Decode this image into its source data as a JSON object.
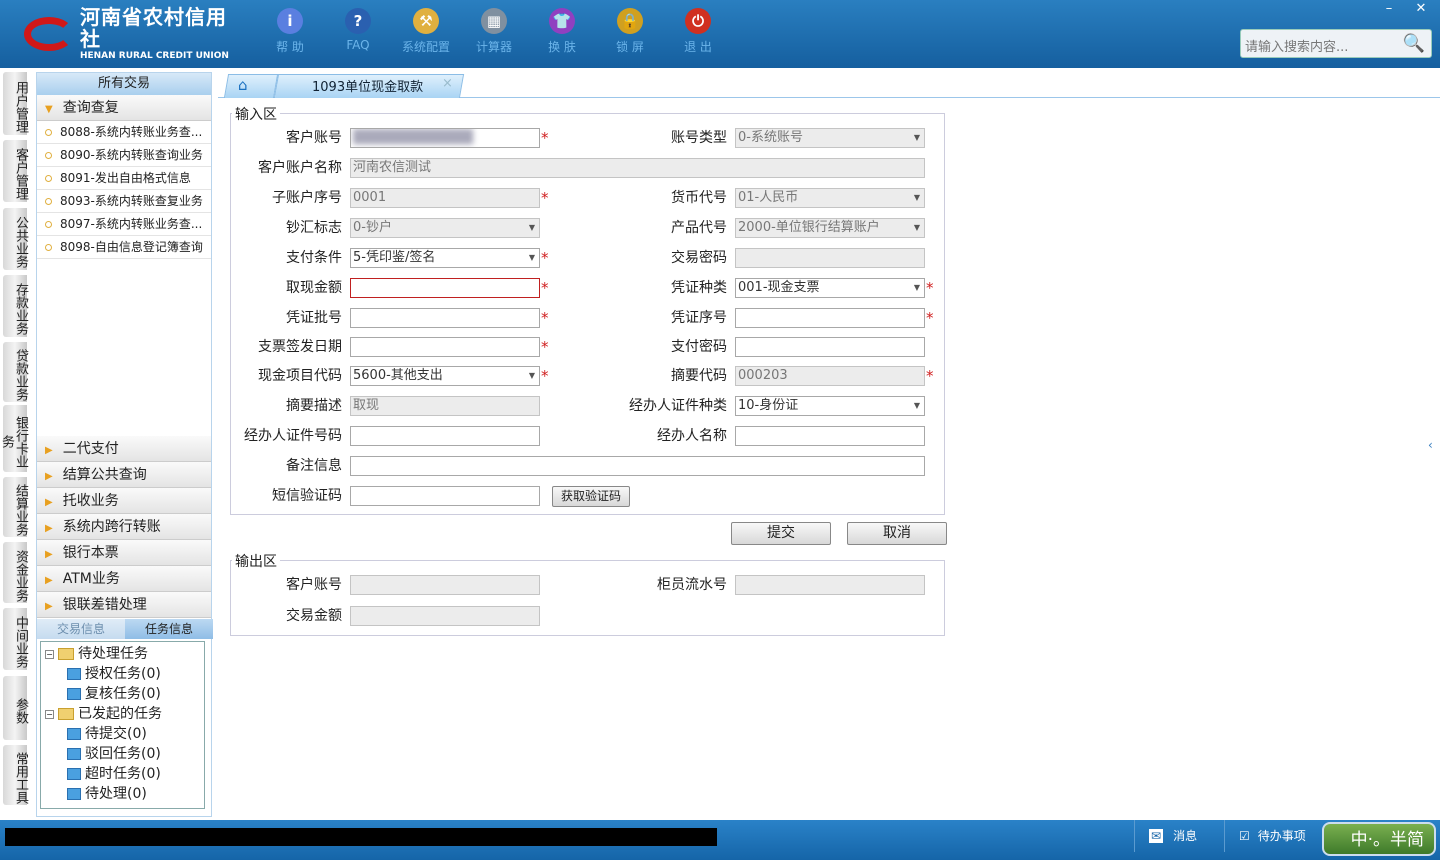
{
  "header": {
    "logo_cn": "河南省农村信用社",
    "logo_en": "HENAN RURAL CREDIT UNION",
    "tools": [
      {
        "label": "帮 助",
        "icon": "info-icon",
        "color": "#5a7fe0",
        "glyph": "i"
      },
      {
        "label": "FAQ",
        "icon": "help-icon",
        "color": "#2a60b0",
        "glyph": "?"
      },
      {
        "label": "系统配置",
        "icon": "toolbox-icon",
        "color": "#e0b040",
        "glyph": "⚒"
      },
      {
        "label": "计算器",
        "icon": "calculator-icon",
        "color": "#8090a0",
        "glyph": "▦"
      },
      {
        "label": "换 肤",
        "icon": "shirt-icon",
        "color": "#9040c0",
        "glyph": "👕"
      },
      {
        "label": "锁 屏",
        "icon": "lock-icon",
        "color": "#d0a020",
        "glyph": "🔒"
      },
      {
        "label": "退 出",
        "icon": "power-icon",
        "color": "#d03020",
        "glyph": "⏻"
      }
    ],
    "search_placeholder": "请输入搜索内容...",
    "minimize": "–",
    "close": "✕"
  },
  "vtabs": [
    "用户管理",
    "客户管理",
    "公共业务",
    "存款业务",
    "贷款业务",
    "银行卡业务",
    "结算业务",
    "资金业务",
    "中间业务",
    "参数",
    "常用工具"
  ],
  "sidebar": {
    "title": "所有交易",
    "open_group": "查询查复",
    "items": [
      "8088-系统内转账业务查...",
      "8090-系统内转账查询业务",
      "8091-发出自由格式信息",
      "8093-系统内转账查复业务",
      "8097-系统内转账业务查...",
      "8098-自由信息登记簿查询"
    ],
    "groups": [
      "二代支付",
      "结算公共查询",
      "托收业务",
      "系统内跨行转账",
      "银行本票",
      "ATM业务",
      "银联差错处理"
    ],
    "task_tabs": [
      "交易信息",
      "任务信息"
    ],
    "tree": [
      {
        "label": "待处理任务",
        "level": 0,
        "folder": true
      },
      {
        "label": "授权任务(0)",
        "level": 1
      },
      {
        "label": "复核任务(0)",
        "level": 1
      },
      {
        "label": "已发起的任务",
        "level": 0,
        "folder": true
      },
      {
        "label": "待提交(0)",
        "level": 1
      },
      {
        "label": "驳回任务(0)",
        "level": 1
      },
      {
        "label": "超时任务(0)",
        "level": 1
      },
      {
        "label": "待处理(0)",
        "level": 1
      }
    ]
  },
  "tabs": {
    "active": "1093单位现金取款",
    "close": "×"
  },
  "input_area": {
    "legend": "输入区",
    "rows": [
      {
        "l": {
          "label": "客户账号",
          "value": "",
          "blur": true,
          "req": true
        },
        "r": {
          "label": "账号类型",
          "value": "0-系统账号",
          "select": true,
          "dis": true
        }
      },
      {
        "l": {
          "label": "客户账户名称",
          "value": "河南农信测试",
          "dis": true,
          "wide": true
        }
      },
      {
        "l": {
          "label": "子账户序号",
          "value": "0001",
          "dis": true,
          "req": true
        },
        "r": {
          "label": "货币代号",
          "value": "01-人民币",
          "select": true,
          "dis": true
        }
      },
      {
        "l": {
          "label": "钞汇标志",
          "value": "0-钞户",
          "select": true,
          "dis": true
        },
        "r": {
          "label": "产品代号",
          "value": "2000-单位银行结算账户",
          "select": true,
          "dis": true
        }
      },
      {
        "l": {
          "label": "支付条件",
          "value": "5-凭印鉴/签名",
          "select": true,
          "req": true
        },
        "r": {
          "label": "交易密码",
          "value": "",
          "dis": true
        }
      },
      {
        "l": {
          "label": "取现金额",
          "value": "",
          "req": true,
          "err": true
        },
        "r": {
          "label": "凭证种类",
          "value": "001-现金支票",
          "select": true,
          "req": true
        }
      },
      {
        "l": {
          "label": "凭证批号",
          "value": "",
          "req": true
        },
        "r": {
          "label": "凭证序号",
          "value": "",
          "req": true
        }
      },
      {
        "l": {
          "label": "支票签发日期",
          "value": "",
          "req": true
        },
        "r": {
          "label": "支付密码",
          "value": ""
        }
      },
      {
        "l": {
          "label": "现金项目代码",
          "value": "5600-其他支出",
          "select": true,
          "req": true
        },
        "r": {
          "label": "摘要代码",
          "value": "000203",
          "dis": true,
          "req": true
        }
      },
      {
        "l": {
          "label": "摘要描述",
          "value": "取现",
          "dis": true
        },
        "r": {
          "label": "经办人证件种类",
          "value": "10-身份证",
          "select": true
        }
      },
      {
        "l": {
          "label": "经办人证件号码",
          "value": ""
        },
        "r": {
          "label": "经办人名称",
          "value": ""
        }
      },
      {
        "l": {
          "label": "备注信息",
          "value": "",
          "wide": true
        }
      },
      {
        "l": {
          "label": "短信验证码",
          "value": ""
        },
        "btn": "获取验证码"
      }
    ]
  },
  "actions": {
    "submit": "提交",
    "cancel": "取消"
  },
  "output_area": {
    "legend": "输出区",
    "rows": [
      {
        "l": {
          "label": "客户账号",
          "value": "",
          "dis": true
        },
        "r": {
          "label": "柜员流水号",
          "value": "",
          "dis": true
        }
      },
      {
        "l": {
          "label": "交易金额",
          "value": "",
          "dis": true
        }
      }
    ]
  },
  "statusbar": {
    "messages": "消息",
    "todo": "待办事项",
    "ime": "中·。半简"
  }
}
